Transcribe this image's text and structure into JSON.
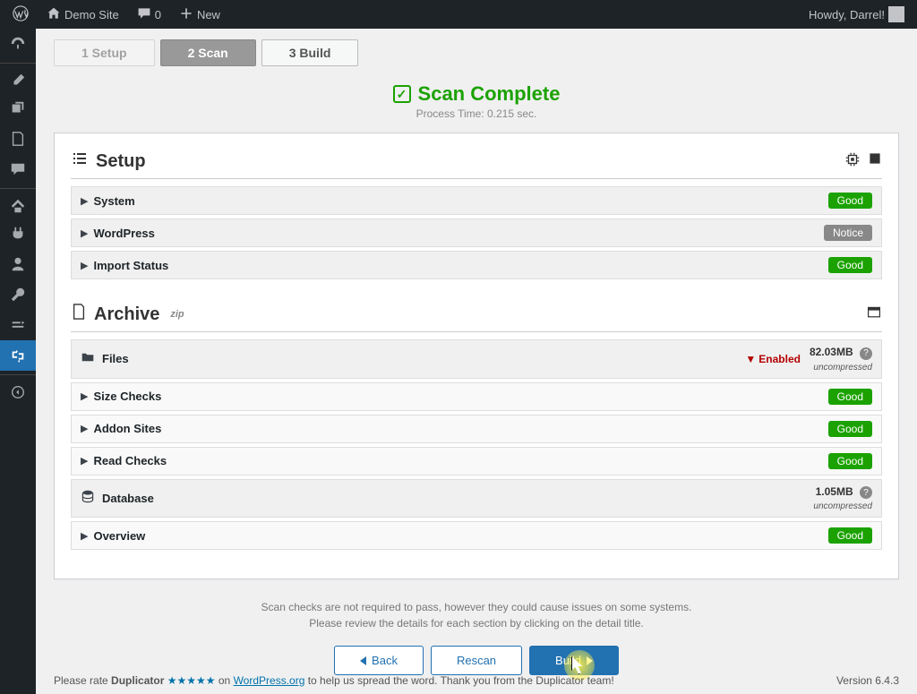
{
  "topbar": {
    "site": "Demo Site",
    "comments": "0",
    "new": "New",
    "howdy": "Howdy, Darrel!"
  },
  "steps": {
    "s1": "1 Setup",
    "s2": "2 Scan",
    "s3": "3 Build"
  },
  "scan": {
    "title": "Scan Complete",
    "subtitle": "Process Time: 0.215 sec."
  },
  "sections": {
    "setup": {
      "title": "Setup"
    },
    "archive": {
      "title": "Archive",
      "sup": "zip"
    }
  },
  "rows": {
    "system": {
      "label": "System",
      "badge": "Good"
    },
    "wordpress": {
      "label": "WordPress",
      "badge": "Notice"
    },
    "import": {
      "label": "Import Status",
      "badge": "Good"
    },
    "files": {
      "label": "Files",
      "filter": "Enabled",
      "size": "82.03MB",
      "note": "uncompressed"
    },
    "sizeChecks": {
      "label": "Size Checks",
      "badge": "Good"
    },
    "addon": {
      "label": "Addon Sites",
      "badge": "Good"
    },
    "read": {
      "label": "Read Checks",
      "badge": "Good"
    },
    "database": {
      "label": "Database",
      "size": "1.05MB",
      "note": "uncompressed"
    },
    "overview": {
      "label": "Overview",
      "badge": "Good"
    }
  },
  "footer": {
    "l1": "Scan checks are not required to pass, however they could cause issues on some systems.",
    "l2": "Please review the details for each section by clicking on the detail title."
  },
  "buttons": {
    "back": "Back",
    "rescan": "Rescan",
    "build": "Build"
  },
  "rate": {
    "pre": "Please rate ",
    "name": "Duplicator",
    "stars": "★★★★★",
    "mid": " on ",
    "link": "WordPress.org",
    "post": " to help us spread the word. Thank you from the Duplicator team!",
    "version": "Version 6.4.3"
  }
}
